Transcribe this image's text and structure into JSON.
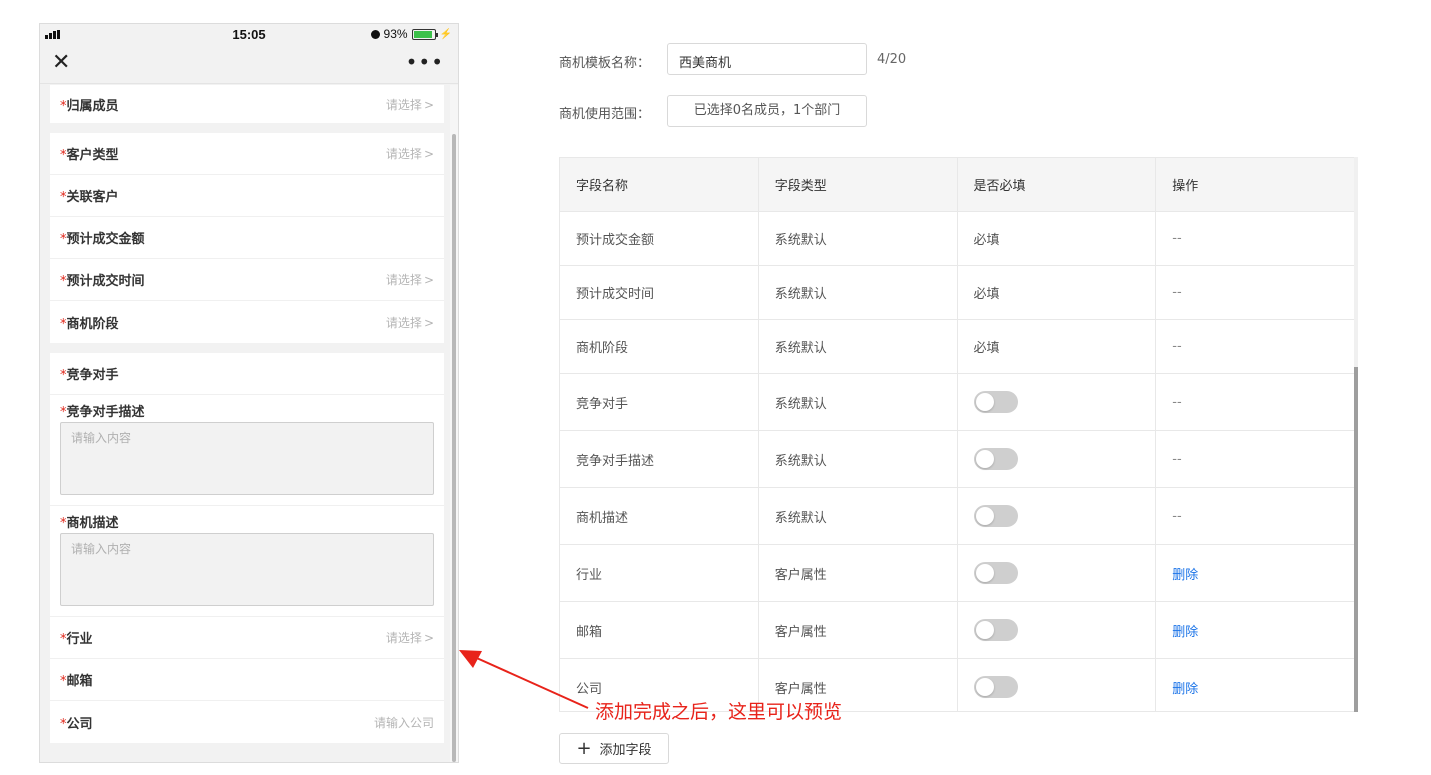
{
  "phone": {
    "status": {
      "time": "15:05",
      "battery": "93%"
    },
    "form": {
      "rows": {
        "owner": {
          "label": "归属成员",
          "action": "请选择"
        },
        "customer_type": {
          "label": "客户类型",
          "action": "请选择"
        },
        "related_customer": {
          "label": "关联客户"
        },
        "expected_amount": {
          "label": "预计成交金额"
        },
        "expected_time": {
          "label": "预计成交时间",
          "action": "请选择"
        },
        "stage": {
          "label": "商机阶段",
          "action": "请选择"
        },
        "competitor": {
          "label": "竞争对手"
        },
        "competitor_desc": {
          "label": "竞争对手描述",
          "placeholder": "请输入内容"
        },
        "opportunity_desc": {
          "label": "商机描述",
          "placeholder": "请输入内容"
        },
        "industry": {
          "label": "行业",
          "action": "请选择"
        },
        "email": {
          "label": "邮箱"
        },
        "company": {
          "label": "公司",
          "placeholder": "请输入公司"
        }
      },
      "required_mark": "*",
      "chevron": ">"
    }
  },
  "config": {
    "template_name_label": "商机模板名称：",
    "template_name_value": "西美商机",
    "template_name_counter": "4/20",
    "scope_label": "商机使用范围：",
    "scope_value": "已选择0名成员，1个部门",
    "table": {
      "headers": [
        "字段名称",
        "字段类型",
        "是否必填",
        "操作"
      ],
      "rows": [
        {
          "name": "预计成交金额",
          "type": "系统默认",
          "required": "必填",
          "op": "--"
        },
        {
          "name": "预计成交时间",
          "type": "系统默认",
          "required": "必填",
          "op": "--"
        },
        {
          "name": "商机阶段",
          "type": "系统默认",
          "required": "必填",
          "op": "--"
        },
        {
          "name": "竞争对手",
          "type": "系统默认",
          "required_toggle": false,
          "op": "--"
        },
        {
          "name": "竞争对手描述",
          "type": "系统默认",
          "required_toggle": false,
          "op": "--"
        },
        {
          "name": "商机描述",
          "type": "系统默认",
          "required_toggle": false,
          "op": "--"
        },
        {
          "name": "行业",
          "type": "客户属性",
          "required_toggle": false,
          "op": "删除"
        },
        {
          "name": "邮箱",
          "type": "客户属性",
          "required_toggle": false,
          "op": "删除"
        },
        {
          "name": "公司",
          "type": "客户属性",
          "required_toggle": false,
          "op": "删除"
        }
      ]
    },
    "add_button_label": "添加字段"
  },
  "annotation": {
    "text": "添加完成之后，这里可以预览",
    "color": "#e8231a"
  },
  "colors": {
    "accent_link": "#1a73e8",
    "required": "#e0271a"
  },
  "icons": [
    "close-icon",
    "more-icon",
    "chevron-right-icon",
    "plus-icon",
    "signal-icon",
    "alarm-icon",
    "battery-icon"
  ]
}
